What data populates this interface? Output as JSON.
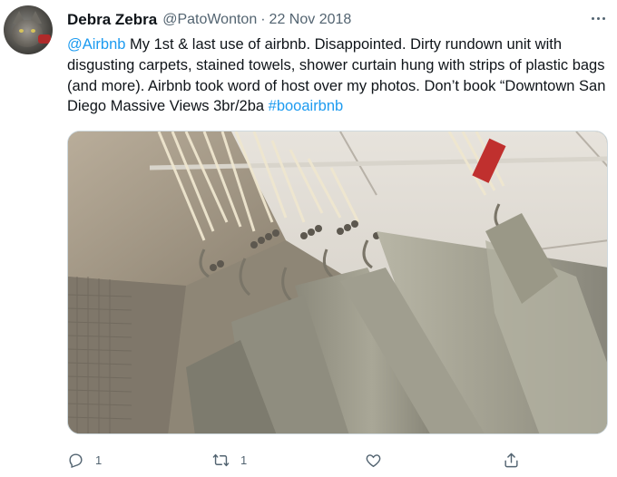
{
  "tweet": {
    "author": {
      "display_name": "Debra Zebra",
      "handle": "@PatoWonton",
      "separator": "·",
      "date": "22 Nov 2018",
      "avatar_icon": "cat-avatar"
    },
    "text": {
      "mention": "@Airbnb",
      "body": " My 1st & last use of airbnb. Disappointed.  Dirty rundown unit with disgusting carpets, stained towels, shower curtain hung with strips of plastic bags (and more). Airbnb took word of host over my photos. Don’t book “Downtown San Diego Massive Views 3br/2ba  ",
      "hashtag": "#booairbnb"
    },
    "media": {
      "icon": "shower-curtain-photo"
    },
    "actions": {
      "reply": {
        "icon": "reply-icon",
        "count": "1"
      },
      "retweet": {
        "icon": "retweet-icon",
        "count": "1"
      },
      "like": {
        "icon": "like-icon",
        "count": ""
      },
      "share": {
        "icon": "share-icon",
        "count": ""
      }
    },
    "colors": {
      "link": "#1d9bf0",
      "text": "#0f1419",
      "muted": "#536471",
      "border": "#cfd9de"
    }
  }
}
